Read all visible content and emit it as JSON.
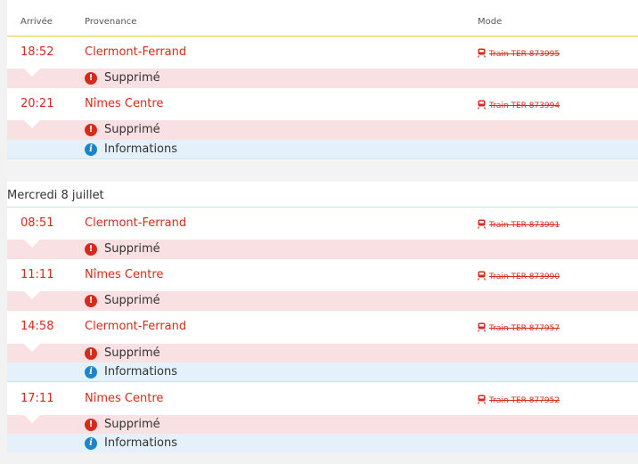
{
  "columns": {
    "arrival": "Arrivée",
    "origin": "Provenance",
    "mode": "Mode"
  },
  "trips": [
    {
      "time": "18:52",
      "origin": "Clermont-Ferrand",
      "mode": "Train TER 873995",
      "status": "Supprimé",
      "info": null
    },
    {
      "time": "20:21",
      "origin": "Nîmes Centre",
      "mode": "Train TER 873994",
      "status": "Supprimé",
      "info": "Informations"
    },
    {
      "time": "08:51",
      "origin": "Clermont-Ferrand",
      "mode": "Train TER 873991",
      "status": "Supprimé",
      "info": null
    },
    {
      "time": "11:11",
      "origin": "Nîmes Centre",
      "mode": "Train TER 873990",
      "status": "Supprimé",
      "info": null
    },
    {
      "time": "14:58",
      "origin": "Clermont-Ferrand",
      "mode": "Train TER 877957",
      "status": "Supprimé",
      "info": "Informations"
    },
    {
      "time": "17:11",
      "origin": "Nîmes Centre",
      "mode": "Train TER 877952",
      "status": "Supprimé",
      "info": "Informations"
    }
  ],
  "day_separator": "Mercredi 8 juillet",
  "colors": {
    "cancelled": "#d52b1e",
    "cancelled_bg": "#f9e0e3",
    "info_bg": "#e4f1fa",
    "info_icon": "#1f84c7",
    "header_border": "#f3c623"
  },
  "icons": {
    "mode": "train-icon",
    "status": "alert-icon",
    "info": "info-icon"
  }
}
